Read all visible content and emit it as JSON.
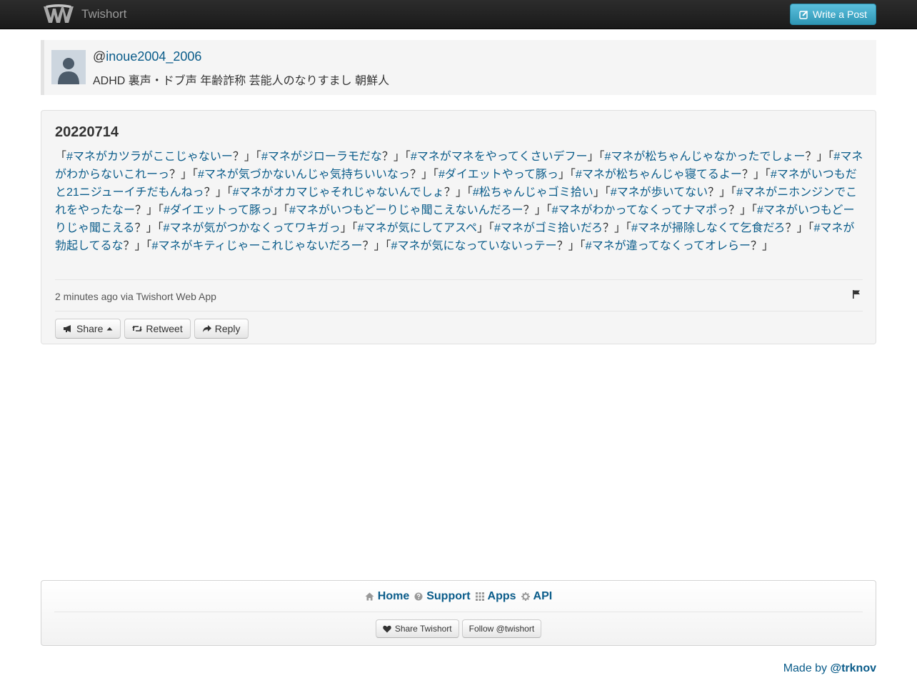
{
  "navbar": {
    "brand": "Twishort",
    "write_label": "Write a Post"
  },
  "profile": {
    "at": "@",
    "username": "inoue2004_2006",
    "bio": "ADHD 裏声・ドブ声 年齢詐称 芸能人のなりすまし 朝鮮人"
  },
  "post": {
    "title": "20220714",
    "segments": [
      {
        "t": "「"
      },
      {
        "h": "#マネがカツラがここじゃないー"
      },
      {
        "t": "？」「"
      },
      {
        "h": "#マネがジローラモだな"
      },
      {
        "t": "？」「"
      },
      {
        "h": "#マネがマネをやってくさいデフー"
      },
      {
        "t": "」「"
      },
      {
        "h": "#マネが松ちゃんじゃなかったでしょー"
      },
      {
        "t": "？」「"
      },
      {
        "h": "#マネがわからないこれーっ"
      },
      {
        "t": "？」「"
      },
      {
        "h": "#マネが気づかないんじゃ気持ちいいなっ"
      },
      {
        "t": "？」「"
      },
      {
        "h": "#ダイエットやって豚っ"
      },
      {
        "t": "」「"
      },
      {
        "h": "#マネが松ちゃんじゃ寝てるよー"
      },
      {
        "t": "？」「"
      },
      {
        "h": "#マネがいつもだと21ニジューイチだもんねっ"
      },
      {
        "t": "？」「"
      },
      {
        "h": "#マネがオカマじゃそれじゃないんでしょ"
      },
      {
        "t": "？」「"
      },
      {
        "h": "#松ちゃんじゃゴミ拾い"
      },
      {
        "t": "」「"
      },
      {
        "h": "#マネが歩いてない"
      },
      {
        "t": "？」「"
      },
      {
        "h": "#マネがニホンジンでこれをやったなー"
      },
      {
        "t": "？」「"
      },
      {
        "h": "#ダイエットって豚っ"
      },
      {
        "t": "」「"
      },
      {
        "h": "#マネがいつもどーりじゃ聞こえないんだろー"
      },
      {
        "t": "？」「"
      },
      {
        "h": "#マネがわかってなくってナマポっ"
      },
      {
        "t": "？」「"
      },
      {
        "h": "#マネがいつもどーりじゃ聞こえる"
      },
      {
        "t": "？」「"
      },
      {
        "h": "#マネが気がつかなくってワキガっ"
      },
      {
        "t": "」「"
      },
      {
        "h": "#マネが気にしてアスペ"
      },
      {
        "t": "」「"
      },
      {
        "h": "#マネがゴミ拾いだろ"
      },
      {
        "t": "？」「"
      },
      {
        "h": "#マネが掃除しなくて乞食だろ"
      },
      {
        "t": "？」「"
      },
      {
        "h": "#マネが勃起してるな"
      },
      {
        "t": "？」「"
      },
      {
        "h": "#マネがキティじゃーこれじゃないだろー"
      },
      {
        "t": "？」「"
      },
      {
        "h": "#マネが気になっていないっテー"
      },
      {
        "t": "？」「"
      },
      {
        "h": "#マネが違ってなくってオレらー"
      },
      {
        "t": "？」"
      }
    ],
    "meta": "2 minutes ago via Twishort Web App",
    "share_label": "Share",
    "retweet_label": "Retweet",
    "reply_label": "Reply"
  },
  "footer": {
    "nav": [
      {
        "label": "Home",
        "icon": "home-icon"
      },
      {
        "label": "Support",
        "icon": "question-circle-icon"
      },
      {
        "label": "Apps",
        "icon": "grid-icon"
      },
      {
        "label": "API",
        "icon": "cog-icon"
      }
    ],
    "share_label": "Share Twishort",
    "follow_label": "Follow @twishort"
  },
  "madeby": {
    "prefix": "Made by ",
    "author": "@trknov"
  },
  "colors": {
    "link": "#0a5c8a",
    "write_button": "#2f96b4",
    "navbar": "#1a1a1a"
  }
}
